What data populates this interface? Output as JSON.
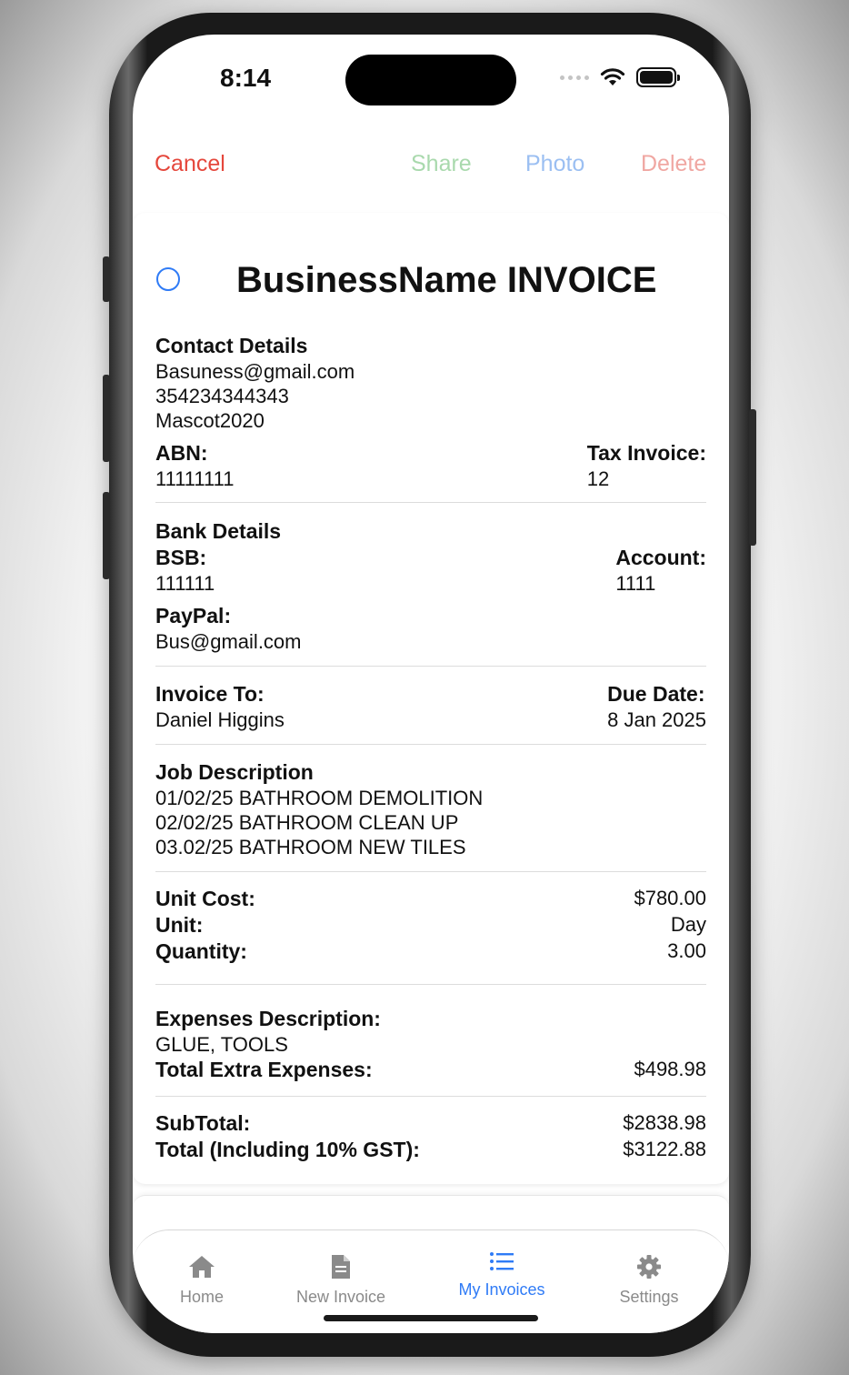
{
  "status_bar": {
    "time": "8:14"
  },
  "nav": {
    "cancel": "Cancel",
    "share": "Share",
    "photo": "Photo",
    "delete": "Delete"
  },
  "invoice": {
    "title": "BusinessName INVOICE",
    "contact": {
      "heading": "Contact Details",
      "email": "Basuness@gmail.com",
      "phone": "354234344343",
      "line3": "Mascot2020",
      "abn_label": "ABN:",
      "abn_value": "11111111",
      "tax_invoice_label": "Tax Invoice:",
      "tax_invoice_value": "12"
    },
    "bank": {
      "heading": "Bank Details",
      "bsb_label": "BSB:",
      "bsb_value": "111111",
      "account_label": "Account:",
      "account_value": "1111",
      "paypal_label": "PayPal:",
      "paypal_value": "Bus@gmail.com"
    },
    "billing": {
      "to_label": "Invoice To:",
      "to_value": "Daniel Higgins",
      "due_label": "Due Date:",
      "due_value": "8 Jan 2025"
    },
    "job": {
      "heading": "Job Description",
      "lines": [
        "01/02/25 BATHROOM DEMOLITION",
        "02/02/25 BATHROOM CLEAN UP",
        "03.02/25 BATHROOM NEW TILES"
      ]
    },
    "costs": {
      "unit_cost_label": "Unit Cost:",
      "unit_cost_value": "$780.00",
      "unit_label": "Unit:",
      "unit_value": "Day",
      "quantity_label": "Quantity:",
      "quantity_value": "3.00"
    },
    "expenses": {
      "description_label": "Expenses Description:",
      "description_value": "GLUE, TOOLS",
      "total_label": "Total Extra Expenses:",
      "total_value": "$498.98"
    },
    "totals": {
      "subtotal_label": "SubTotal:",
      "subtotal_value": "$2838.98",
      "total_label": "Total (Including 10% GST):",
      "total_value": "$3122.88"
    }
  },
  "tabs": [
    {
      "label": "Home",
      "icon": "house-icon"
    },
    {
      "label": "New Invoice",
      "icon": "document-icon"
    },
    {
      "label": "My Invoices",
      "icon": "list-icon",
      "active": true
    },
    {
      "label": "Settings",
      "icon": "gear-icon"
    }
  ],
  "colors": {
    "cancel": "#e5473c",
    "share": "#a9d9ad",
    "photo": "#9bbff2",
    "delete": "#f0a7a2",
    "accent": "#2f7bf6",
    "tab_inactive": "#8a8a8a"
  }
}
